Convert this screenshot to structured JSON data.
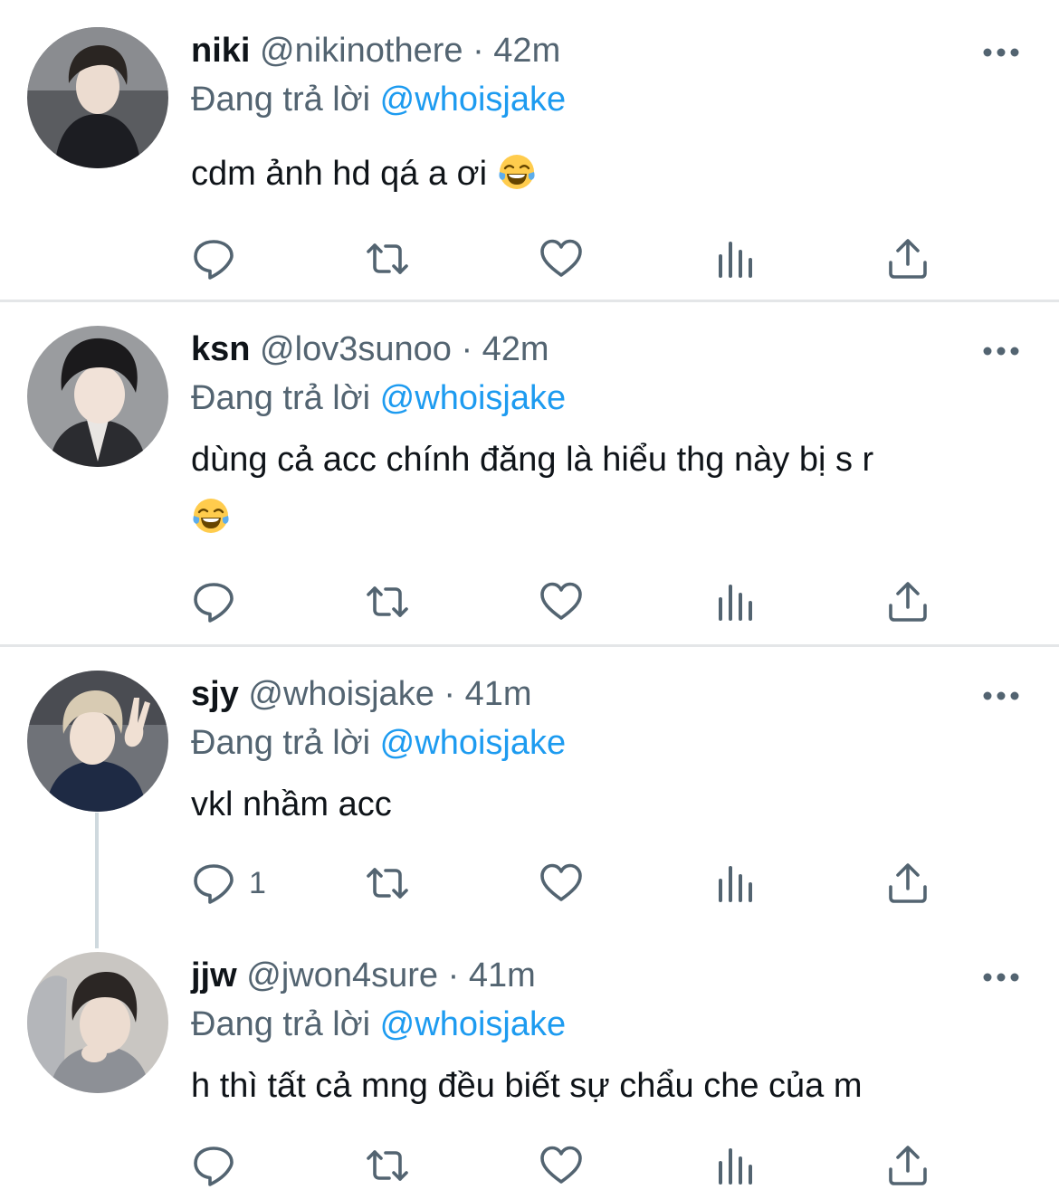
{
  "colors": {
    "accent": "#1d9bf0",
    "secondary": "#536471",
    "text": "#0f1419",
    "divider": "#e4e6e8"
  },
  "tweets": [
    {
      "name": "niki",
      "handle": "@nikinothere",
      "separator": "·",
      "time": "42m",
      "reply_prefix": "Đang trả lời",
      "reply_to": "@whoisjake",
      "text": "cdm ảnh hd qá a ơi",
      "emoji": "joy-emoji",
      "reply_count": ""
    },
    {
      "name": "ksn",
      "handle": "@lov3sunoo",
      "separator": "·",
      "time": "42m",
      "reply_prefix": "Đang trả lời",
      "reply_to": "@whoisjake",
      "text": "dùng cả acc chính đăng là hiểu thg này bị s r",
      "emoji": "joy-emoji",
      "reply_count": ""
    },
    {
      "name": "sjy",
      "handle": "@whoisjake",
      "separator": "·",
      "time": "41m",
      "reply_prefix": "Đang trả lời",
      "reply_to": "@whoisjake",
      "text": "vkl nhầm acc",
      "reply_count": "1"
    },
    {
      "name": "jjw",
      "handle": "@jwon4sure",
      "separator": "·",
      "time": "41m",
      "reply_prefix": "Đang trả lời",
      "reply_to": "@whoisjake",
      "text": "h thì tất cả mng đều biết sự chẩu che của m",
      "reply_count": ""
    }
  ],
  "icons": [
    "reply-icon",
    "retweet-icon",
    "like-icon",
    "analytics-icon",
    "share-icon",
    "more-icon"
  ]
}
